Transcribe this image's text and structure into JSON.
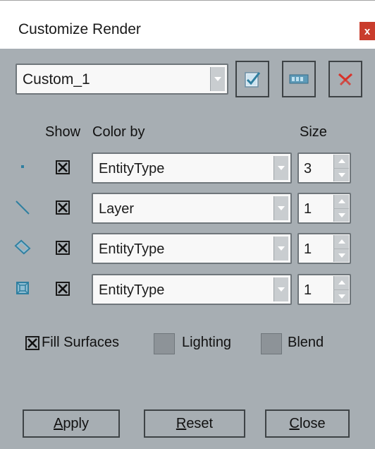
{
  "dialog": {
    "title": "Customize Render",
    "close_glyph": "x"
  },
  "preset": {
    "value": "Custom_1"
  },
  "toolbar": {
    "save_icon": "check-document-icon",
    "rename_icon": "rename-icon",
    "delete_icon": "delete-x-icon"
  },
  "headers": {
    "show": "Show",
    "color_by": "Color by",
    "size": "Size"
  },
  "rows": [
    {
      "icon": "point-icon",
      "show": true,
      "color_by": "EntityType",
      "size": "3"
    },
    {
      "icon": "line-icon",
      "show": true,
      "color_by": "Layer",
      "size": "1"
    },
    {
      "icon": "surface-icon",
      "show": true,
      "color_by": "EntityType",
      "size": "1"
    },
    {
      "icon": "solid-icon",
      "show": true,
      "color_by": "EntityType",
      "size": "1"
    }
  ],
  "options": {
    "fill_surfaces": {
      "label": "Fill Surfaces",
      "checked": true
    },
    "lighting": {
      "label": "Lighting",
      "checked": false
    },
    "blend": {
      "label": "Blend",
      "checked": false
    }
  },
  "buttons": {
    "apply": {
      "mnemonic": "A",
      "rest": "pply"
    },
    "reset": {
      "mnemonic": "R",
      "rest": "eset"
    },
    "close": {
      "mnemonic": "C",
      "rest": "lose"
    }
  },
  "colors": {
    "dialog_bg": "#a7aeb3",
    "close_red": "#c93c2c",
    "icon_teal": "#2f7fa0"
  }
}
